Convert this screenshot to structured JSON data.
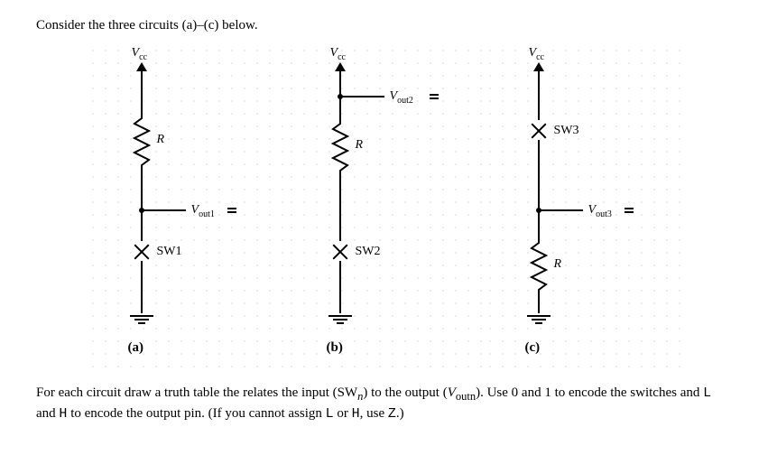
{
  "intro": "Consider the three circuits (a)–(c) below.",
  "circuits": {
    "a": {
      "vcc": "V",
      "vcc_sub": "cc",
      "r_label": "R",
      "sw_label": "SW1",
      "vout_label": "V",
      "vout_sub": "out1",
      "caption": "(a)"
    },
    "b": {
      "vcc": "V",
      "vcc_sub": "cc",
      "r_label": "R",
      "sw_label": "SW2",
      "vout_label": "V",
      "vout_sub": "out2",
      "caption": "(b)"
    },
    "c": {
      "vcc": "V",
      "vcc_sub": "cc",
      "r_label": "R",
      "sw_label": "SW3",
      "vout_label": "V",
      "vout_sub": "out3",
      "caption": "(c)"
    }
  },
  "footer_part1": "For each circuit draw a truth table the relates the input (SW",
  "footer_sub1": "n",
  "footer_part2": ") to the output (",
  "footer_voutn": "V",
  "footer_sub2": "outn",
  "footer_part3": "). Use 0 and 1 to encode the switches and ",
  "footer_L": "L",
  "footer_and": " and ",
  "footer_H": "H",
  "footer_part4": " to encode the output pin. (If you cannot assign ",
  "footer_L2": "L",
  "footer_or": " or ",
  "footer_H2": "H",
  "footer_part5": ", use ",
  "footer_Z": "Z",
  "footer_part6": ".)",
  "chart_data": [
    {
      "type": "diagram",
      "id": "a",
      "title": "(a)",
      "top_node": "Vcc",
      "series_path": [
        "R",
        "Vout1 tap",
        "SW1 (open)",
        "GND"
      ],
      "vout_position": "between R and SW1"
    },
    {
      "type": "diagram",
      "id": "b",
      "title": "(b)",
      "top_node": "Vcc",
      "series_path": [
        "Vout2 tap",
        "R",
        "SW2 (open)",
        "GND"
      ],
      "vout_position": "above R (at Vcc node)"
    },
    {
      "type": "diagram",
      "id": "c",
      "title": "(c)",
      "top_node": "Vcc",
      "series_path": [
        "SW3 (open)",
        "Vout3 tap",
        "R",
        "GND"
      ],
      "vout_position": "between SW3 and R"
    }
  ]
}
